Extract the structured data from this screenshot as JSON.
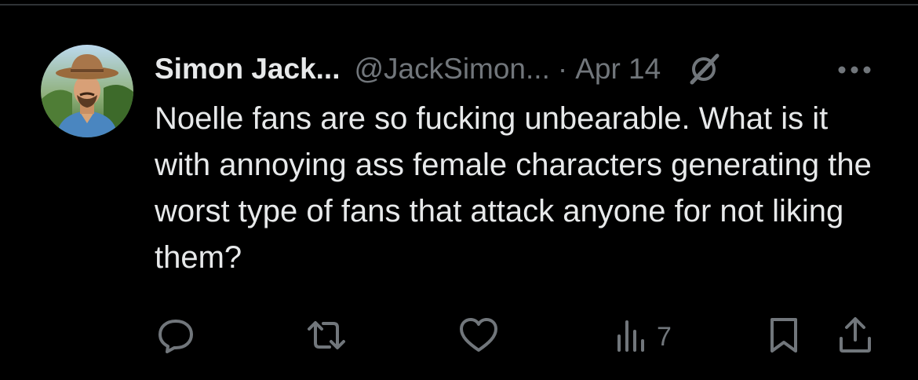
{
  "tweet": {
    "author_name": "Simon Jack...",
    "handle": "@JackSimon...",
    "separator": "·",
    "date": "Apr 14",
    "text": "Noelle fans are so fucking unbearable. What is it with annoying ass female characters generating the worst type of fans that attack anyone for not liking them?"
  },
  "actions": {
    "views_count": "7"
  },
  "icons": {
    "header": [
      "grok-icon",
      "more-icon"
    ],
    "actions": [
      "reply-icon",
      "retweet-icon",
      "like-icon",
      "views-icon",
      "bookmark-icon",
      "share-icon"
    ]
  },
  "colors": {
    "background": "#000000",
    "primary_text": "#e7e9ea",
    "secondary_text": "#71767b",
    "divider": "#2f3336"
  }
}
